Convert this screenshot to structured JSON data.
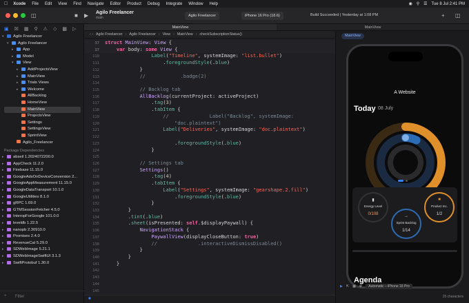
{
  "menubar": {
    "app": "Xcode",
    "items": [
      "File",
      "Edit",
      "View",
      "Find",
      "Navigate",
      "Editor",
      "Product",
      "Debug",
      "Integrate",
      "Window",
      "Help"
    ],
    "datetime": "Tue 8 Jul  2:41 PM"
  },
  "toolbar": {
    "project_title": "Agilo Freelancer",
    "project_sub": "main",
    "scheme": "Agilo Freelancer",
    "device": "iPhone 16 Pro (18.6)",
    "status": "Build Succeeded | Yesterday at 1:08 PM"
  },
  "tabs": [
    "MainView",
    "MainView"
  ],
  "navigator": {
    "tree": [
      {
        "label": "Agilo Freelancer",
        "depth": 0,
        "kind": "app",
        "chev": "open"
      },
      {
        "label": "Agilo Freelancer",
        "depth": 1,
        "kind": "folder",
        "chev": "open"
      },
      {
        "label": "App",
        "depth": 2,
        "kind": "folder",
        "chev": "closed"
      },
      {
        "label": "Model",
        "depth": 2,
        "kind": "folder",
        "chev": "closed"
      },
      {
        "label": "View",
        "depth": 2,
        "kind": "folder",
        "chev": "open"
      },
      {
        "label": "AddProjectsView",
        "depth": 3,
        "kind": "folder",
        "chev": "closed"
      },
      {
        "label": "MainView",
        "depth": 3,
        "kind": "folder",
        "chev": "closed"
      },
      {
        "label": "Trials Views",
        "depth": 3,
        "kind": "folder",
        "chev": "closed"
      },
      {
        "label": "Welcome",
        "depth": 3,
        "kind": "folder",
        "chev": "closed"
      },
      {
        "label": "AllBacklog",
        "depth": 3,
        "kind": "swift"
      },
      {
        "label": "HomeView",
        "depth": 3,
        "kind": "swift"
      },
      {
        "label": "MainView",
        "depth": 3,
        "kind": "swift",
        "selected": true
      },
      {
        "label": "ProjectsView",
        "depth": 3,
        "kind": "swift"
      },
      {
        "label": "Settings",
        "depth": 3,
        "kind": "swift"
      },
      {
        "label": "SettingsView",
        "depth": 3,
        "kind": "swift"
      },
      {
        "label": "SprintView",
        "depth": 3,
        "kind": "swift"
      },
      {
        "label": "Agilo_Freelancer",
        "depth": 2,
        "kind": "swift"
      }
    ],
    "packages_header": "Package Dependencies",
    "packages": [
      "abseil 1.2024072200.0",
      "AppCheck 11.2.0",
      "Firebase 11.15.0",
      "GoogleAdsOnDeviceConversion 2...",
      "GoogleAppMeasurement 11.15.0",
      "GoogleDataTransport 10.1.0",
      "GoogleUtilities 8.1.0",
      "gRPC 1.69.0",
      "GTMSessionFetcher 4.5.0",
      "InteropForGoogle 101.0.0",
      "leveldb 1.22.5",
      "nanopb 2.30910.0",
      "Promises 2.4.0",
      "RevenueCat 5.29.0",
      "SDWebImage 5.21.1",
      "SDWebImageSwiftUI 3.1.3",
      "SwiftProtobuf 1.30.0"
    ],
    "filter_placeholder": "Filter"
  },
  "jumpbar": [
    "Agilo Freelancer",
    "Agilo Freelancer",
    "View",
    "MainView",
    "checkSubscriptionStatus()"
  ],
  "editor": {
    "sticky": [
      {
        "num": "37",
        "html": "<span class=\"kw\">struct</span> <span class=\"ty\">MainView</span>: <span class=\"ty\">View</span> {"
      },
      {
        "num": "37",
        "html": "    <span class=\"kw\">var</span> body: <span class=\"kw\">some</span> <span class=\"ty\">View</span> {"
      }
    ],
    "lines": [
      {
        "num": "110",
        "html": "                <span class=\"fn\">Label</span>(<span class=\"st\">\"Timeline\"</span>, systemImage: <span class=\"st\">\"list.bullet\"</span>)"
      },
      {
        "num": "111",
        "html": "                    .<span class=\"fn\">foregroundStyle</span>(.<span class=\"fn\">blue</span>)"
      },
      {
        "num": "112",
        "html": "            }"
      },
      {
        "num": "113",
        "html": "<span class=\"cm\">            //            .badge(2)</span>"
      },
      {
        "num": "114",
        "html": ""
      },
      {
        "num": "115",
        "html": "<span class=\"cm\">            // Backlog tab</span>"
      },
      {
        "num": "116",
        "html": "            <span class=\"ty\">AllBacklog</span>(currentProject: activeProject)"
      },
      {
        "num": "117",
        "html": "                .<span class=\"fn\">tag</span>(<span class=\"nm\">3</span>)"
      },
      {
        "num": "118",
        "html": "                .<span class=\"fn\">tabItem</span> {"
      },
      {
        "num": "119",
        "html": "<span class=\"cm\">                    //              Label(\"Backlog\", systemImage:</span>"
      },
      {
        "num": "120",
        "html": "<span class=\"cm\">                        \"doc.plaintext\")</span>"
      },
      {
        "num": "121",
        "html": "                    <span class=\"fn\">Label</span>(<span class=\"st\">\"Deliveries\"</span>, systemImage: <span class=\"st\">\"doc.plaintext\"</span>)"
      },
      {
        "num": "122",
        "html": ""
      },
      {
        "num": "123",
        "html": "                        .<span class=\"fn\">foregroundStyle</span>(.<span class=\"fn\">blue</span>)"
      },
      {
        "num": "124",
        "html": "                }"
      },
      {
        "num": "125",
        "html": ""
      },
      {
        "num": "126",
        "html": "<span class=\"cm\">            // Settings tab</span>"
      },
      {
        "num": "127",
        "html": "            <span class=\"ty\">Settings</span>()"
      },
      {
        "num": "128",
        "html": "                .<span class=\"fn\">tag</span>(<span class=\"nm\">4</span>)"
      },
      {
        "num": "129",
        "html": "                .<span class=\"fn\">tabItem</span> {"
      },
      {
        "num": "130",
        "html": "                    <span class=\"fn\">Label</span>(<span class=\"st\">\"Settings\"</span>, systemImage: <span class=\"st\">\"gearshape.2.fill\"</span>)"
      },
      {
        "num": "131",
        "html": "                        .<span class=\"fn\">foregroundStyle</span>(.<span class=\"fn\">blue</span>)"
      },
      {
        "num": "132",
        "html": "                }"
      },
      {
        "num": "133",
        "html": "        }"
      },
      {
        "num": "134",
        "html": "        .<span class=\"fn\">tint</span>(.<span class=\"fn\">blue</span>)"
      },
      {
        "num": "135",
        "html": "        .<span class=\"fn\">sheet</span>(isPresented: <span class=\"kw\">self</span>.$displayPaywall) {"
      },
      {
        "num": "136",
        "html": "            <span class=\"ty\">NavigationStack</span> {"
      },
      {
        "num": "137",
        "html": "                <span class=\"ty\">PaywallView</span>(displayCloseButton: <span class=\"kw\">true</span>)"
      },
      {
        "num": "138",
        "html": "<span class=\"cm\">                //              .interactiveDismissDisabled()</span>"
      },
      {
        "num": "139",
        "html": "            }"
      },
      {
        "num": "140",
        "html": "        }"
      },
      {
        "num": "141",
        "html": "    }"
      },
      {
        "num": "142",
        "html": ""
      },
      {
        "num": "143",
        "html": ""
      },
      {
        "num": "144",
        "html": ""
      },
      {
        "num": "145",
        "html": ""
      },
      {
        "num": "146",
        "html": ""
      },
      {
        "num": "147",
        "html": ""
      }
    ]
  },
  "canvas": {
    "pill": "MainView",
    "app_title": "A Website",
    "today": "Today",
    "date": "08 July",
    "stats": [
      {
        "label": "Energy Level",
        "value": "0/108"
      },
      {
        "label": "Sprint Backlog",
        "value": "1/14"
      },
      {
        "label": "Product Inc.",
        "value": "1/2"
      }
    ],
    "agenda": "Agenda",
    "device_selector": "Automatic – iPhone 16 Pro",
    "chars": "25 characters"
  },
  "colors": {
    "accent": "#3a82f7",
    "ring_orange": "#e0902a",
    "ring_blue": "#2b6cb5"
  }
}
